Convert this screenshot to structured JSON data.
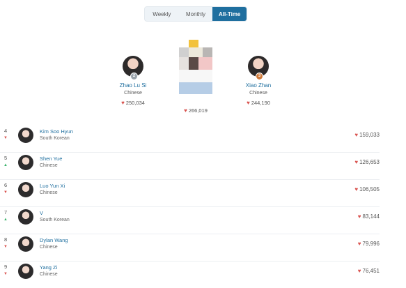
{
  "tabs": [
    {
      "label": "Weekly",
      "active": false
    },
    {
      "label": "Monthly",
      "active": false
    },
    {
      "label": "All-Time",
      "active": true
    }
  ],
  "podium": [
    {
      "rank": 2,
      "name": "Zhao Lu Si",
      "nationality": "Chinese",
      "votes": "250,034",
      "medal_color": "#9aa3ab"
    },
    {
      "rank": 1,
      "name": "",
      "nationality": "",
      "votes": "266,019",
      "medal_color": "#e7b416"
    },
    {
      "rank": 3,
      "name": "Xiao Zhan",
      "nationality": "Chinese",
      "votes": "244,190",
      "medal_color": "#d07a3a"
    }
  ],
  "list": [
    {
      "rank": "4",
      "trend": "down",
      "name": "Kim Soo Hyun",
      "nationality": "South Korean",
      "votes": "159,033"
    },
    {
      "rank": "5",
      "trend": "up",
      "name": "Shen Yue",
      "nationality": "Chinese",
      "votes": "126,653"
    },
    {
      "rank": "6",
      "trend": "down",
      "name": "Luo Yun Xi",
      "nationality": "Chinese",
      "votes": "106,505"
    },
    {
      "rank": "7",
      "trend": "up",
      "name": "V",
      "nationality": "South Korean",
      "votes": "83,144"
    },
    {
      "rank": "8",
      "trend": "down",
      "name": "Dylan Wang",
      "nationality": "Chinese",
      "votes": "79,996"
    },
    {
      "rank": "9",
      "trend": "down",
      "name": "Yang Zi",
      "nationality": "Chinese",
      "votes": "76,451"
    }
  ],
  "icons": {
    "vote": "heart-vote-icon",
    "trend_up": "arrow-up-icon",
    "trend_down": "arrow-down-icon"
  }
}
